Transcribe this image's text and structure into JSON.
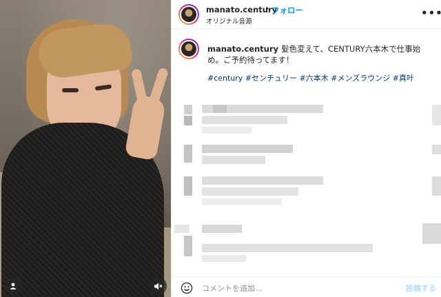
{
  "post": {
    "username": "manato.century",
    "follow_label": "フォロー",
    "audio_label": "オリジナル音源",
    "more_icon": "more-horizontal-icon",
    "caption_text": "髪色変えて、CENTURY六本木で仕事始め。ご予約待ってます！",
    "hashtags": "#century #センチュリー #六本木 #メンズラウンジ #真叶"
  },
  "footer": {
    "comment_placeholder": "コメントを追加...",
    "post_label": "投稿する"
  },
  "media": {
    "user_tag_icon": "user-icon",
    "mute_icon": "volume-mute-icon"
  },
  "colors": {
    "accent": "#0095f6",
    "hashtag": "#00376b",
    "post_disabled": "#b2dffc"
  }
}
